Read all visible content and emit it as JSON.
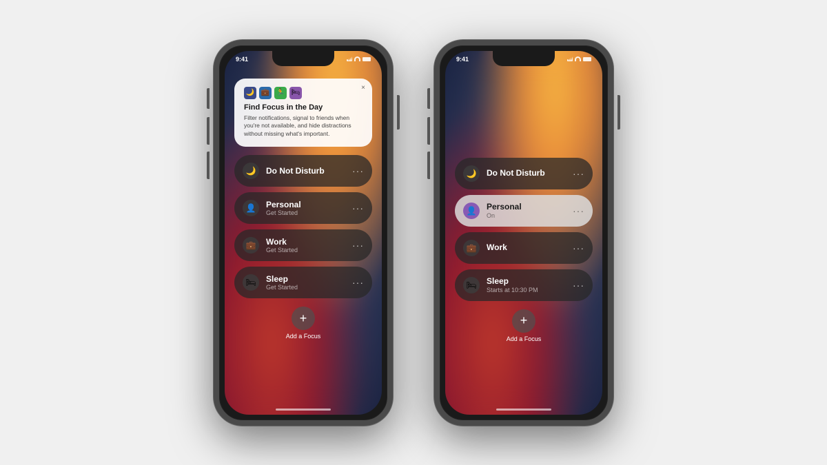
{
  "page": {
    "background": "#f0f0f0"
  },
  "phone1": {
    "status": {
      "time": "9:41",
      "icons": [
        "signal",
        "wifi",
        "battery"
      ]
    },
    "tooltip": {
      "title": "Find Focus in the Day",
      "description": "Filter notifications, signal to friends when you're not available, and hide distractions without missing what's important.",
      "icons": [
        "moon",
        "briefcase",
        "figure",
        "bed"
      ],
      "close_label": "×"
    },
    "focus_items": [
      {
        "id": "do-not-disturb",
        "icon": "🌙",
        "name": "Do Not Disturb",
        "sub": "",
        "active": false
      },
      {
        "id": "personal",
        "icon": "👤",
        "name": "Personal",
        "sub": "Get Started",
        "active": false
      },
      {
        "id": "work",
        "icon": "💼",
        "name": "Work",
        "sub": "Get Started",
        "active": false
      },
      {
        "id": "sleep",
        "icon": "🛏",
        "name": "Sleep",
        "sub": "Get Started",
        "active": false
      }
    ],
    "add_focus": {
      "label": "Add a Focus",
      "icon": "+"
    }
  },
  "phone2": {
    "status": {
      "time": "9:41",
      "icons": [
        "signal",
        "wifi",
        "battery"
      ]
    },
    "focus_items": [
      {
        "id": "do-not-disturb",
        "icon": "🌙",
        "name": "Do Not Disturb",
        "sub": "",
        "active": false
      },
      {
        "id": "personal",
        "icon": "👤",
        "name": "Personal",
        "sub": "On",
        "active": true
      },
      {
        "id": "work",
        "icon": "💼",
        "name": "Work",
        "sub": "",
        "active": false
      },
      {
        "id": "sleep",
        "icon": "🛏",
        "name": "Sleep",
        "sub": "Starts at 10:30 PM",
        "active": false
      }
    ],
    "add_focus": {
      "label": "Add a Focus",
      "icon": "+"
    }
  }
}
